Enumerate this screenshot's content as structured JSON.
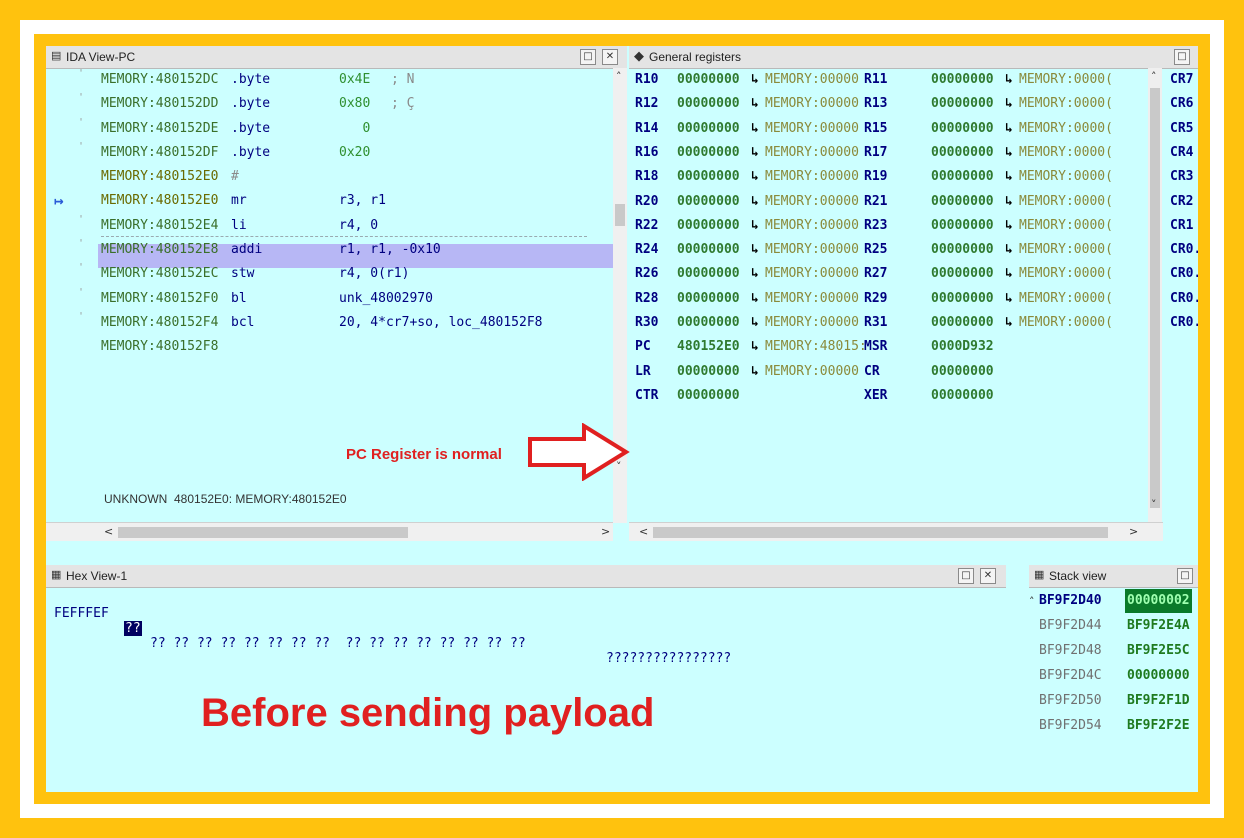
{
  "ida_view": {
    "title": "IDA View-PC",
    "lines": [
      {
        "addr": "MEMORY:480152DC",
        "mn": ".byte",
        "op": "0x4E",
        "cmt": "; N"
      },
      {
        "addr": "MEMORY:480152DD",
        "mn": ".byte",
        "op": "0x80",
        "cmt": "; Ç"
      },
      {
        "addr": "MEMORY:480152DE",
        "mn": ".byte",
        "op": "   0",
        "cmt": ""
      },
      {
        "addr": "MEMORY:480152DF",
        "mn": ".byte",
        "op": "0x20",
        "cmt": ""
      },
      {
        "addr": "MEMORY:480152E0",
        "mn": "#",
        "op": "",
        "cmt": ""
      },
      {
        "addr": "MEMORY:480152E0",
        "mn": "mr",
        "op": "r3, r1",
        "cmt": ""
      },
      {
        "addr": "MEMORY:480152E4",
        "mn": "li",
        "op": "r4, 0",
        "cmt": ""
      },
      {
        "addr": "MEMORY:480152E8",
        "mn": "addi",
        "op": "r1, r1, -0x10",
        "cmt": ""
      },
      {
        "addr": "MEMORY:480152EC",
        "mn": "stw",
        "op": "r4, 0(r1)",
        "cmt": ""
      },
      {
        "addr": "MEMORY:480152F0",
        "mn": "bl",
        "op": "unk_48002970",
        "cmt": ""
      },
      {
        "addr": "MEMORY:480152F4",
        "mn": "bcl",
        "op": "20, 4*cr7+so, loc_480152F8",
        "cmt": ""
      },
      {
        "addr": "MEMORY:480152F8",
        "mn": "",
        "op": "",
        "cmt": ""
      }
    ],
    "status_line": "UNKNOWN  480152E0: MEMORY:480152E0",
    "annotation": "PC Register is normal"
  },
  "registers": {
    "title": "General registers",
    "rows": [
      {
        "r1": "R10",
        "v1": "00000000",
        "m1": "MEMORY:00000",
        "r2": "R11",
        "v2": "00000000",
        "m2": "MEMORY:0000(",
        "cr": "CR7"
      },
      {
        "r1": "R12",
        "v1": "00000000",
        "m1": "MEMORY:00000",
        "r2": "R13",
        "v2": "00000000",
        "m2": "MEMORY:0000(",
        "cr": "CR6"
      },
      {
        "r1": "R14",
        "v1": "00000000",
        "m1": "MEMORY:00000",
        "r2": "R15",
        "v2": "00000000",
        "m2": "MEMORY:0000(",
        "cr": "CR5"
      },
      {
        "r1": "R16",
        "v1": "00000000",
        "m1": "MEMORY:00000",
        "r2": "R17",
        "v2": "00000000",
        "m2": "MEMORY:0000(",
        "cr": "CR4"
      },
      {
        "r1": "R18",
        "v1": "00000000",
        "m1": "MEMORY:00000",
        "r2": "R19",
        "v2": "00000000",
        "m2": "MEMORY:0000(",
        "cr": "CR3"
      },
      {
        "r1": "R20",
        "v1": "00000000",
        "m1": "MEMORY:00000",
        "r2": "R21",
        "v2": "00000000",
        "m2": "MEMORY:0000(",
        "cr": "CR2"
      },
      {
        "r1": "R22",
        "v1": "00000000",
        "m1": "MEMORY:00000",
        "r2": "R23",
        "v2": "00000000",
        "m2": "MEMORY:0000(",
        "cr": "CR1"
      },
      {
        "r1": "R24",
        "v1": "00000000",
        "m1": "MEMORY:00000",
        "r2": "R25",
        "v2": "00000000",
        "m2": "MEMORY:0000(",
        "cr": "CR0."
      },
      {
        "r1": "R26",
        "v1": "00000000",
        "m1": "MEMORY:00000",
        "r2": "R27",
        "v2": "00000000",
        "m2": "MEMORY:0000(",
        "cr": "CR0."
      },
      {
        "r1": "R28",
        "v1": "00000000",
        "m1": "MEMORY:00000",
        "r2": "R29",
        "v2": "00000000",
        "m2": "MEMORY:0000(",
        "cr": "CR0."
      },
      {
        "r1": "R30",
        "v1": "00000000",
        "m1": "MEMORY:00000",
        "r2": "R31",
        "v2": "00000000",
        "m2": "MEMORY:0000(",
        "cr": "CR0."
      },
      {
        "r1": "PC",
        "v1": "480152E0",
        "m1": "MEMORY:48015:",
        "r2": "MSR",
        "v2": "0000D932",
        "m2": "",
        "cr": ""
      },
      {
        "r1": "LR",
        "v1": "00000000",
        "m1": "MEMORY:00000",
        "r2": "CR",
        "v2": "00000000",
        "m2": "",
        "cr": ""
      },
      {
        "r1": "CTR",
        "v1": "00000000",
        "m1": "",
        "r2": "XER",
        "v2": "00000000",
        "m2": "",
        "cr": ""
      }
    ]
  },
  "hex_view": {
    "title": "Hex View-1",
    "prefix": "FEFFFEF",
    "first_byte": "??",
    "bytes": "?? ?? ?? ?? ?? ?? ?? ??  ?? ?? ?? ?? ?? ?? ?? ??",
    "ascii": "????????????????",
    "caption": "Before sending payload"
  },
  "stack_view": {
    "title": "Stack view",
    "rows": [
      {
        "addr": "BF9F2D40",
        "val": "00000002",
        "highlight": true
      },
      {
        "addr": "BF9F2D44",
        "val": "BF9F2E4A",
        "highlight": false
      },
      {
        "addr": "BF9F2D48",
        "val": "BF9F2E5C",
        "highlight": false
      },
      {
        "addr": "BF9F2D4C",
        "val": "00000000",
        "highlight": false
      },
      {
        "addr": "BF9F2D50",
        "val": "BF9F2F1D",
        "highlight": false
      },
      {
        "addr": "BF9F2D54",
        "val": "BF9F2F2E",
        "highlight": false
      }
    ]
  },
  "colors": {
    "frame": "#ffc20e",
    "background": "#ccffff",
    "highlight": "#b7b7f5",
    "annotation": "#e02020"
  }
}
